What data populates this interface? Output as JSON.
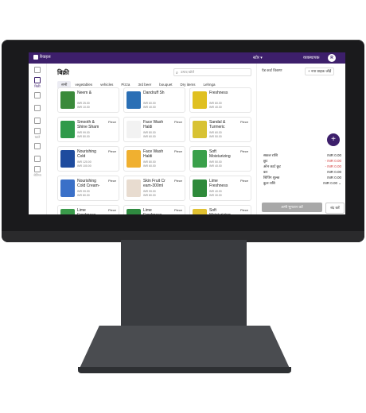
{
  "topbar": {
    "app_name": "रिवाइज",
    "store": "स्टोर ▾",
    "user": "व्यवस्थापक",
    "avatar_letter": "R"
  },
  "sidebar": {
    "items": [
      {
        "label": "",
        "icon": "cart-icon"
      },
      {
        "label": "बिक्री",
        "icon": "receipt-icon"
      },
      {
        "label": "",
        "icon": "users-icon"
      },
      {
        "label": "",
        "icon": "box-icon"
      },
      {
        "label": "",
        "icon": "chart-icon"
      },
      {
        "label": "खाते",
        "icon": "wallet-icon"
      },
      {
        "label": "",
        "icon": "gear-icon"
      },
      {
        "label": "",
        "icon": "tag-icon"
      },
      {
        "label": "सेटिंग्स",
        "icon": "settings-icon"
      }
    ]
  },
  "main": {
    "title": "बिक्री",
    "search_placeholder": "उत्पाद खोजें",
    "categories": [
      "सभी",
      "vegetables",
      "vehicles",
      "Pizza",
      "3rd beer",
      "bouquet",
      "Dry items",
      "Lehnga"
    ],
    "products": [
      {
        "name": "Neem &",
        "unit": "",
        "price": "INR 25.00\nINR 10.00",
        "color": "#3a8a3a"
      },
      {
        "name": "Dandruff Sh",
        "unit": "",
        "price": "INR 60.00\nINR 40.00",
        "color": "#2b6fb5"
      },
      {
        "name": "Freshness",
        "unit": "",
        "price": "INR 60.00\nINR 40.00",
        "color": "#e0c020"
      },
      {
        "name": "Smooth &\nShine Sham",
        "unit": "Piece",
        "price": "INR 99.00\nINR 80.00",
        "color": "#2f9a4a"
      },
      {
        "name": "Face Wash\nHaldi",
        "unit": "Piece",
        "price": "INR 80.00\nINR 60.00",
        "color": "#f2f2f2"
      },
      {
        "name": "Sandal &\nTurmeric",
        "unit": "Piece",
        "price": "INR 60.00\nINR 50.00",
        "color": "#d8c232"
      },
      {
        "name": "Nourishing\nCold",
        "unit": "Piece",
        "price": "INR 120.00\nINR 100.00",
        "color": "#1e4b9e"
      },
      {
        "name": "Face Wash\nHaldi",
        "unit": "Piece",
        "price": "INR 80.00\nINR 60.00",
        "color": "#f0b030"
      },
      {
        "name": "Soft\nMoisturizing",
        "unit": "Piece",
        "price": "INR 50.00\nINR 40.00",
        "color": "#3aa04a"
      },
      {
        "name": "Nourishing\nCold Cream-",
        "unit": "Piece",
        "price": "INR 99.00\nINR 80.00",
        "color": "#3a70c8"
      },
      {
        "name": "Skin Fruit Cr\neam-300ml",
        "unit": "Piece",
        "price": "INR 99.00\nINR 80.00",
        "color": "#e8dcd0"
      },
      {
        "name": "Lime\nFreshness",
        "unit": "Piece",
        "price": "INR 40.00\nINR 30.00",
        "color": "#2e8a3a"
      },
      {
        "name": "Lime\nFreshness",
        "unit": "Piece",
        "price": "",
        "color": "#3a9a4a"
      },
      {
        "name": "Lime\nFreshness",
        "unit": "Piece",
        "price": "",
        "color": "#2f8a40"
      },
      {
        "name": "Soft\nMoisturizing",
        "unit": "Piece",
        "price": "",
        "color": "#e0c030"
      }
    ]
  },
  "cart": {
    "btn_customer": "ऐड कार्ट विवरण",
    "btn_new": "+ नया ग्राहक जोड़ें",
    "summary": [
      {
        "label": "सकल राशि",
        "value": "INR 0.00",
        "red": false
      },
      {
        "label": "छूट",
        "value": "- INR 0.00",
        "red": true
      },
      {
        "label": "ऑन कार्ट छूट",
        "value": "- INR 0.00",
        "red": true
      },
      {
        "label": "कर",
        "value": "INR 0.00",
        "red": false
      },
      {
        "label": "शिपिंग शुल्क",
        "value": "INR 0.00",
        "red": false
      },
      {
        "label": "कुल राशि",
        "value": "INR 0.00 ⌄",
        "red": false
      }
    ],
    "pay_label": "अभी भुगतान करें",
    "close_label": "बंद करें"
  }
}
